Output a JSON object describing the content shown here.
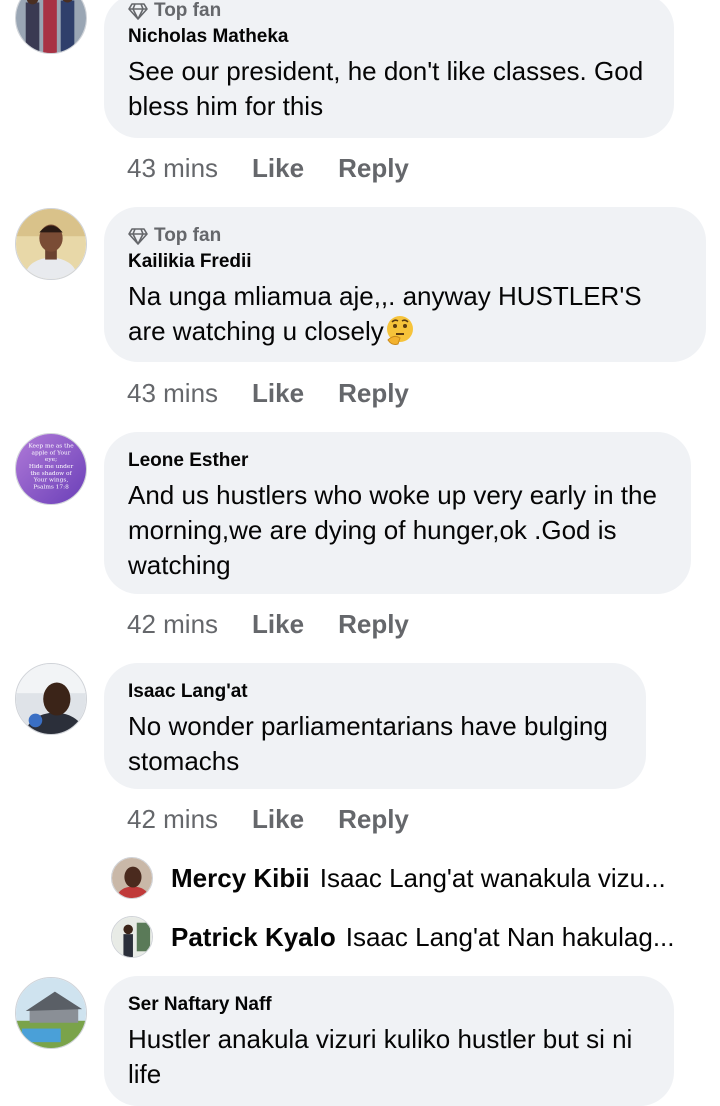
{
  "comments": [
    {
      "badge": "Top fan",
      "author": "Nicholas Matheka",
      "text": "See our president, he don't like classes. God bless him for this",
      "time": "43 mins",
      "like": "Like",
      "reply": "Reply"
    },
    {
      "badge": "Top fan",
      "author": "Kailikia Fredii",
      "text": "Na unga mliamua aje,,. anyway HUSTLER'S are watching u closely",
      "emoji": "thinking-face",
      "time": "43 mins",
      "like": "Like",
      "reply": "Reply"
    },
    {
      "author": "Leone Esther",
      "text": "And us hustlers who woke up very early in the morning,we are dying of hunger,ok .God is watching",
      "avatar_text": [
        "Keep me as the",
        "apple of Your",
        "eye;",
        "Hide me under",
        "the shadow of",
        "Your wings,",
        "Psalms 17:8"
      ],
      "time": "42 mins",
      "like": "Like",
      "reply": "Reply"
    },
    {
      "author": "Isaac Lang'at",
      "text": "No wonder parliamentarians have bulging stomachs",
      "time": "42 mins",
      "like": "Like",
      "reply": "Reply"
    },
    {
      "author": "Ser Naftary Naff",
      "text": "Hustler anakula vizuri kuliko hustler but si ni life"
    }
  ],
  "replies": [
    {
      "name": "Mercy Kibii",
      "text": "Isaac Lang'at wanakula vizu..."
    },
    {
      "name": "Patrick Kyalo",
      "text": "Isaac Lang'at Nan hakulag..."
    }
  ],
  "colors": {
    "bubble": "#f0f2f5",
    "secondary_text": "#65676b",
    "primary_text": "#050505"
  }
}
